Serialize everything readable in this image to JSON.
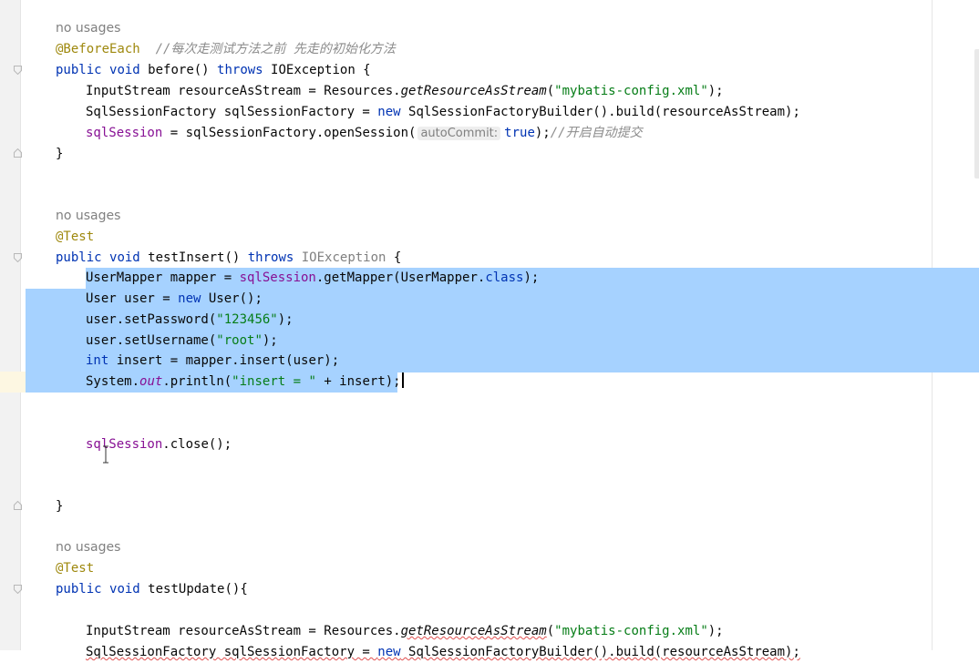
{
  "editor": {
    "usage_hint": "no usages",
    "block1": {
      "annotation": "@BeforeEach",
      "comment": "//每次走测试方法之前 先走的初始化方法",
      "sig": {
        "kw1": "public",
        "kw2": "void",
        "name": "before() ",
        "kw3": "throws",
        "exc": " IOException {"
      },
      "l1": {
        "a": "InputStream resourceAsStream = Resources.",
        "m": "getResourceAsStream",
        "b": "(",
        "s": "\"mybatis-config.xml\"",
        "c": ");"
      },
      "l2": {
        "a": "SqlSessionFactory sqlSessionFactory = ",
        "kw": "new",
        "b": " SqlSessionFactoryBuilder().build(resourceAsStream);"
      },
      "l3": {
        "f": "sqlSession",
        "a": " = sqlSessionFactory.openSession(",
        "hint": "autoCommit:",
        "kw": "true",
        "b": ");",
        "cmt": "//开启自动提交"
      },
      "close": "}"
    },
    "block2": {
      "annotation": "@Test",
      "sig": {
        "kw1": "public",
        "kw2": "void",
        "name": "testInsert() ",
        "kw3": "throws",
        "exc": " IOException",
        "end": " {"
      },
      "l1": {
        "a": "UserMapper mapper = ",
        "f": "sqlSession",
        "b": ".getMapper(UserMapper.",
        "kw": "class",
        "c": ");"
      },
      "l2": {
        "a": "User user = ",
        "kw": "new",
        "b": " User();"
      },
      "l3": {
        "a": "user.setPassword(",
        "s": "\"123456\"",
        "b": ");"
      },
      "l4": {
        "a": "user.setUsername(",
        "s": "\"root\"",
        "b": ");"
      },
      "l5": {
        "kw": "int",
        "a": " insert = mapper.insert(user);"
      },
      "l6": {
        "a": "System.",
        "o": "out",
        "b": ".println(",
        "s": "\"insert = \"",
        "c": " + insert);"
      },
      "l7": {
        "f": "sqlSession",
        "a": ".close();"
      },
      "close": "}"
    },
    "block3": {
      "annotation": "@Test",
      "sig": {
        "kw1": "public",
        "kw2": "void",
        "name": "testUpdate(){"
      },
      "l1": {
        "a": "InputStream resourceAsStream = Resources.",
        "m": "getResourceAsStream",
        "b": "(",
        "s": "\"mybatis-config.xml\"",
        "c": ");"
      },
      "l2": {
        "a": "SqlSessionFactory sqlSessionFactory = ",
        "kw": "new",
        "b": " SqlSessionFactoryBuilder().build(resourceAsStream);"
      }
    }
  }
}
